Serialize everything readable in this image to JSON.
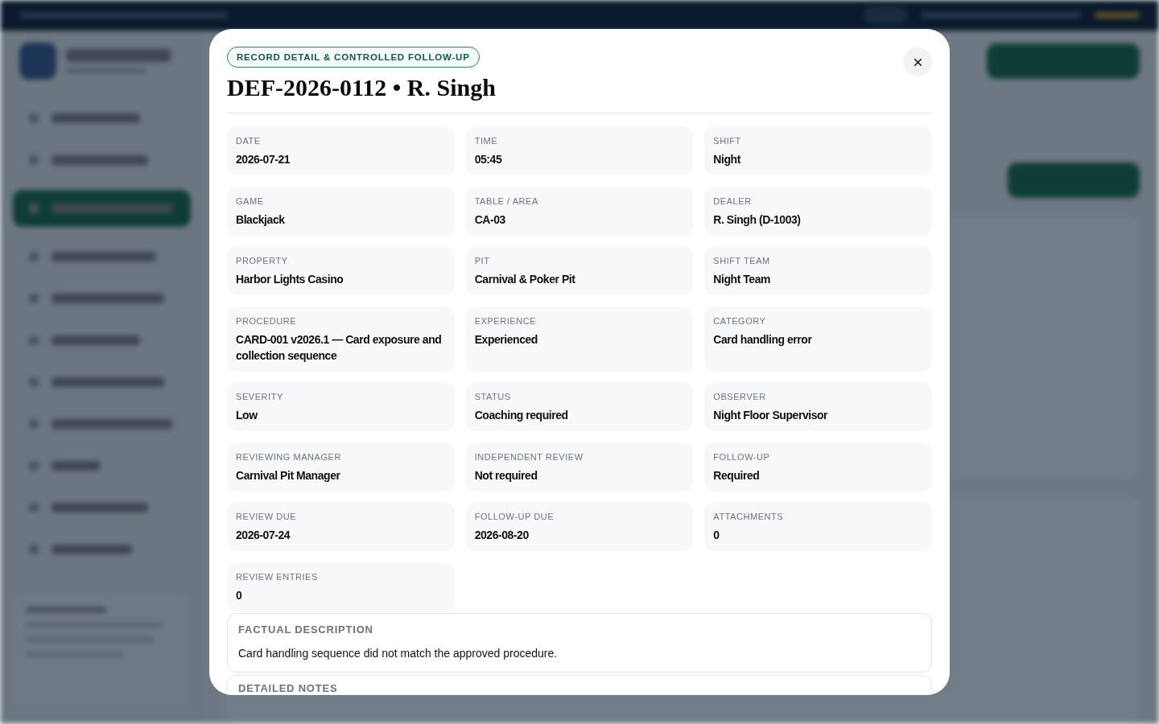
{
  "modal": {
    "badge": "RECORD DETAIL & CONTROLLED FOLLOW-UP",
    "title": "DEF-2026-0112 • R. Singh"
  },
  "fields": [
    {
      "label": "DATE",
      "value": "2026-07-21"
    },
    {
      "label": "TIME",
      "value": "05:45"
    },
    {
      "label": "SHIFT",
      "value": "Night"
    },
    {
      "label": "GAME",
      "value": "Blackjack"
    },
    {
      "label": "TABLE / AREA",
      "value": "CA-03"
    },
    {
      "label": "DEALER",
      "value": "R. Singh (D-1003)"
    },
    {
      "label": "PROPERTY",
      "value": "Harbor Lights Casino"
    },
    {
      "label": "PIT",
      "value": "Carnival & Poker Pit"
    },
    {
      "label": "SHIFT TEAM",
      "value": "Night Team"
    },
    {
      "label": "PROCEDURE",
      "value": "CARD-001 v2026.1 — Card exposure and collection sequence"
    },
    {
      "label": "EXPERIENCE",
      "value": "Experienced"
    },
    {
      "label": "CATEGORY",
      "value": "Card handling error"
    },
    {
      "label": "SEVERITY",
      "value": "Low"
    },
    {
      "label": "STATUS",
      "value": "Coaching required"
    },
    {
      "label": "OBSERVER",
      "value": "Night Floor Supervisor"
    },
    {
      "label": "REVIEWING MANAGER",
      "value": "Carnival Pit Manager"
    },
    {
      "label": "INDEPENDENT REVIEW",
      "value": "Not required"
    },
    {
      "label": "FOLLOW-UP",
      "value": "Required"
    },
    {
      "label": "REVIEW DUE",
      "value": "2026-07-24"
    },
    {
      "label": "FOLLOW-UP DUE",
      "value": "2026-08-20"
    },
    {
      "label": "ATTACHMENTS",
      "value": "0"
    },
    {
      "label": "REVIEW ENTRIES",
      "value": "0"
    }
  ],
  "sections": [
    {
      "heading": "FACTUAL DESCRIPTION",
      "text": "Card handling sequence did not match the approved procedure."
    },
    {
      "heading": "DETAILED NOTES"
    }
  ]
}
